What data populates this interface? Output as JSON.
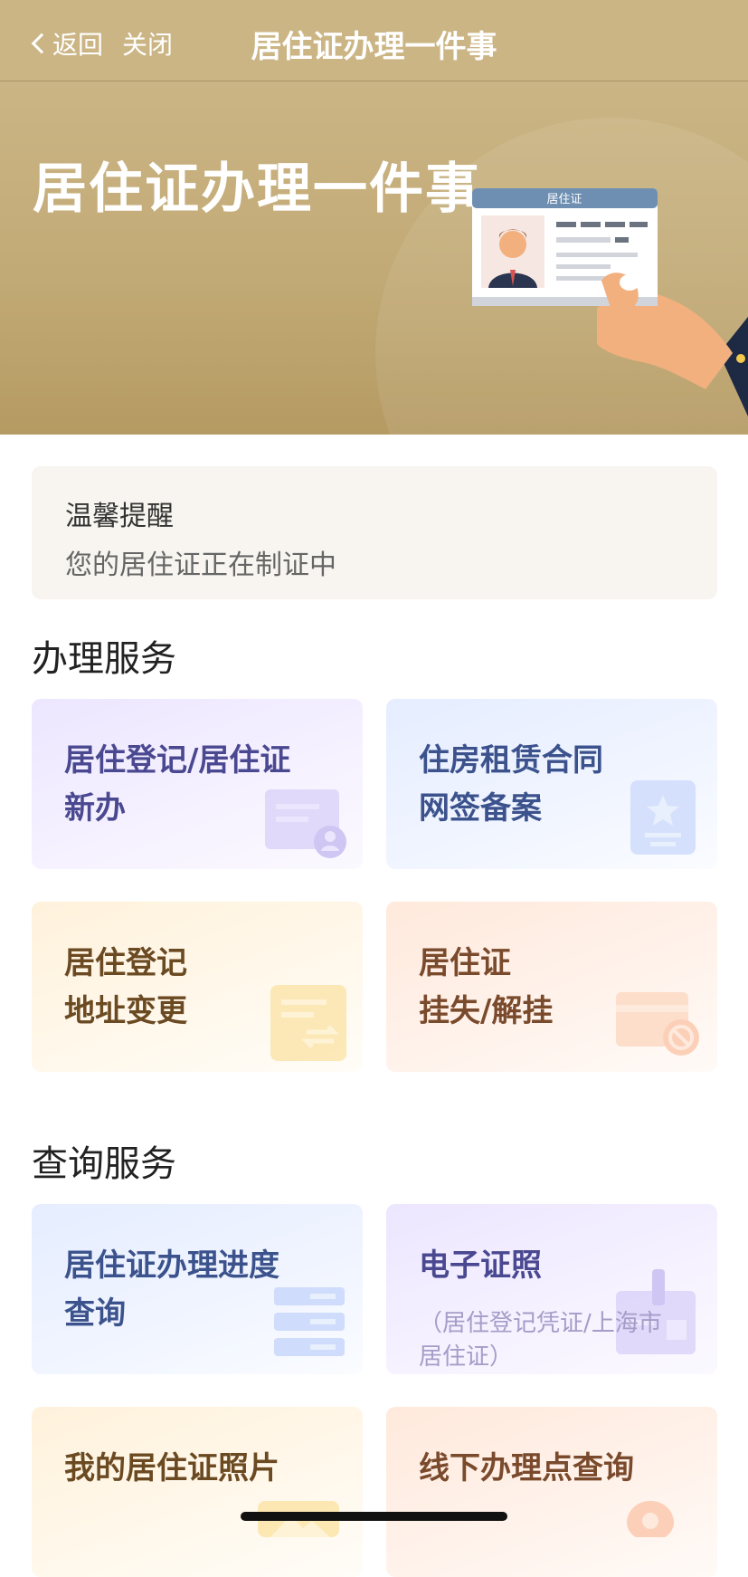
{
  "nav": {
    "back_label": "返回",
    "close_label": "关闭",
    "title": "居住证办理一件事"
  },
  "banner": {
    "title": "居住证办理一件事",
    "card_header": "居住证"
  },
  "tip": {
    "title": "温馨提醒",
    "text": "您的居住证正在制证中"
  },
  "sections": {
    "handle_title": "办理服务",
    "query_title": "查询服务"
  },
  "handle_services": [
    {
      "label": "居住登记/居住证\n新办",
      "icon": "id-card-person-icon",
      "color": "#4a4890"
    },
    {
      "label": "住房租赁合同\n网签备案",
      "icon": "star-document-icon",
      "color": "#3b528c"
    },
    {
      "label": "居住登记\n地址变更",
      "icon": "exchange-document-icon",
      "color": "#6b4a22"
    },
    {
      "label": "居住证\n挂失/解挂",
      "icon": "card-block-icon",
      "color": "#7a4a2c"
    }
  ],
  "query_services": [
    {
      "label": "居住证办理进度\n查询",
      "icon": "progress-list-icon",
      "color": "#3b528c"
    },
    {
      "label": "电子证照",
      "sub": "（居住登记凭证/上海市\n居住证）",
      "icon": "certificate-icon",
      "color": "#4a4890"
    },
    {
      "label": "我的居住证照片",
      "icon": "photo-icon",
      "color": "#6b4a22"
    },
    {
      "label": "线下办理点查询",
      "icon": "location-pin-icon",
      "color": "#7a4a2c"
    }
  ]
}
